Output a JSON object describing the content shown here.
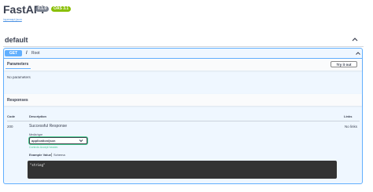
{
  "header": {
    "title": "FastAPI",
    "version_badge": "0.1.0",
    "oas_badge": "OAS 3.1",
    "openapi_link": "/openapi.json"
  },
  "section": {
    "title": "default"
  },
  "operation": {
    "method": "GET",
    "path": "/",
    "description": "Root",
    "parameters_title": "Parameters",
    "try_it_out_label": "Try it out",
    "no_parameters": "No parameters",
    "responses_title": "Responses",
    "table": {
      "headers": {
        "code": "Code",
        "description": "Description",
        "links": "Links"
      },
      "rows": [
        {
          "code": "200",
          "description": "Successful Response",
          "links": "No links",
          "media_type_label": "Media type",
          "media_type": "application/json",
          "media_hint": "Controls Accept header.",
          "tabs": [
            "Example Value",
            "Schema"
          ],
          "example": "\"string\""
        }
      ]
    }
  },
  "colors": {
    "get_accent": "#61affe",
    "op_background": "#eff7ff",
    "oas_badge": "#89bf04",
    "version_badge": "#7d8492",
    "code_background": "#333333",
    "success_green": "#49cc90"
  },
  "icons": [
    "chevron-up-icon"
  ]
}
